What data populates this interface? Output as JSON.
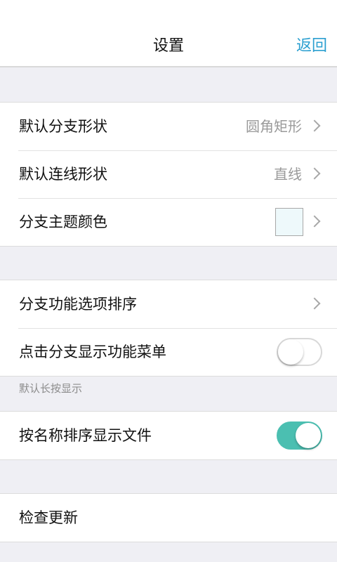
{
  "navbar": {
    "title": "设置",
    "back_label": "返回"
  },
  "group1": {
    "rows": [
      {
        "label": "默认分支形状",
        "value": "圆角矩形"
      },
      {
        "label": "默认连线形状",
        "value": "直线"
      },
      {
        "label": "分支主题颜色",
        "swatch_color": "#eef9fb"
      }
    ]
  },
  "group2": {
    "rows": [
      {
        "label": "分支功能选项排序"
      },
      {
        "label": "点击分支显示功能菜单",
        "toggle": "off"
      }
    ],
    "note": "默认长按显示"
  },
  "group3": {
    "rows": [
      {
        "label": "按名称排序显示文件",
        "toggle": "on"
      }
    ]
  },
  "group4": {
    "rows": [
      {
        "label": "检查更新"
      }
    ]
  },
  "colors": {
    "accent": "#2b9fd0",
    "toggle_on": "#4bbfb1",
    "background": "#efeff4"
  },
  "icons": [
    "chevron-right-icon"
  ]
}
